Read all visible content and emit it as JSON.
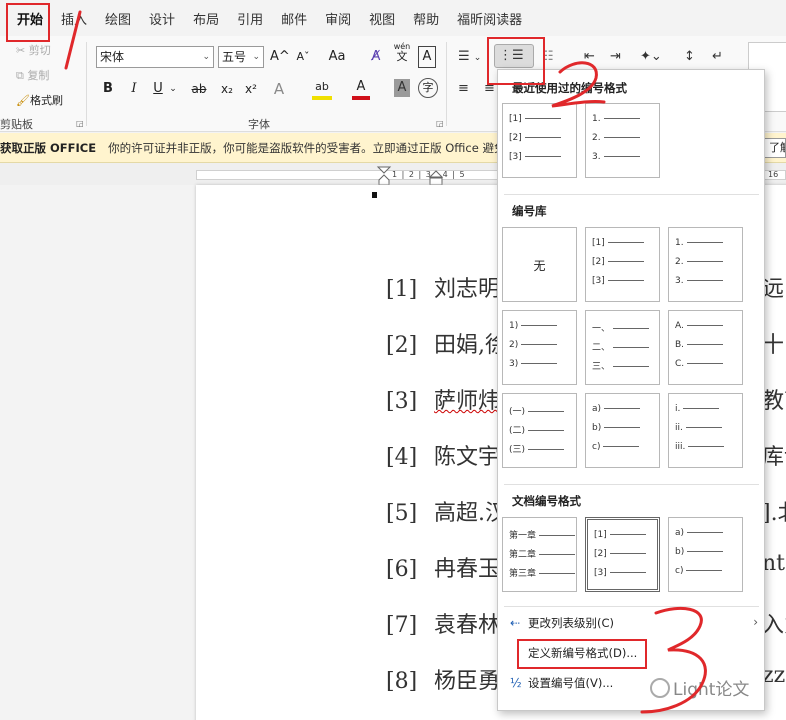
{
  "tabs": [
    "开始",
    "插入",
    "绘图",
    "设计",
    "布局",
    "引用",
    "邮件",
    "审阅",
    "视图",
    "帮助",
    "福昕阅读器"
  ],
  "clipboard": {
    "cut": "剪切",
    "copy": "复制",
    "format_painter": "格式刷",
    "label": "剪贴板"
  },
  "font": {
    "name": "宋体",
    "size": "五号",
    "label": "字体",
    "grow": "A^",
    "shrink": "Aˇ",
    "case": "Aa",
    "phonetic_top": "wén",
    "phonetic_bottom": "文",
    "border": "A",
    "bold": "B",
    "italic": "I",
    "underline": "U",
    "strike": "ab",
    "sub": "x₂",
    "sup": "x²",
    "effects": "A",
    "highlight": "ab",
    "color": "A",
    "shade": "A",
    "enclose": "字"
  },
  "license": {
    "title": "获取正版 OFFICE",
    "message": "你的许可证并非正版，你可能是盗版软件的受害者。立即通过正版 Office 避免中断并确保文件安全",
    "button": "了解"
  },
  "ruler": {
    "marks": "1 | 2 | 3 | 4 | 5",
    "right": "16"
  },
  "references": [
    {
      "num": "[1]",
      "text": "刘志明",
      "right": "远"
    },
    {
      "num": "[2]",
      "text": "田娟,徐",
      "right": "十"
    },
    {
      "num": "[3]",
      "text": "萨师炜",
      "right": "教育"
    },
    {
      "num": "[4]",
      "text": "陈文宇",
      "right": "库讠"
    },
    {
      "num": "[5]",
      "text": "高超.汉",
      "right": "].北"
    },
    {
      "num": "[6]",
      "text": "冉春玉",
      "right": "nts"
    },
    {
      "num": "[7]",
      "text": "袁春林",
      "right": "入力"
    },
    {
      "num": "[8]",
      "text": "杨臣勇",
      "right": "zz"
    }
  ],
  "numbering_menu": {
    "recent_title": "最近使用过的编号格式",
    "library_title": "编号库",
    "document_title": "文档编号格式",
    "none_label": "无",
    "recent": [
      [
        "[1]",
        "[2]",
        "[3]"
      ],
      [
        "1.",
        "2.",
        "3."
      ]
    ],
    "library": [
      [
        "[1]",
        "[2]",
        "[3]"
      ],
      [
        "1.",
        "2.",
        "3."
      ],
      [
        "1)",
        "2)",
        "3)"
      ],
      [
        "一、",
        "二、",
        "三、"
      ],
      [
        "A.",
        "B.",
        "C."
      ],
      [
        "(一)",
        "(二)",
        "(三)"
      ],
      [
        "a)",
        "b)",
        "c)"
      ],
      [
        "i.",
        "ii.",
        "iii."
      ]
    ],
    "document": [
      [
        "第一章",
        "第二章",
        "第三章"
      ],
      [
        "[1]",
        "[2]",
        "[3]"
      ],
      [
        "a)",
        "b)",
        "c)"
      ]
    ],
    "change_level": "更改列表级别(C)",
    "define_new": "定义新编号格式(D)...",
    "set_value": "设置编号值(V)..."
  },
  "watermark": "Light论文",
  "annotations": {
    "color": "#e0282b",
    "marks": [
      "1",
      "2",
      "3"
    ]
  }
}
